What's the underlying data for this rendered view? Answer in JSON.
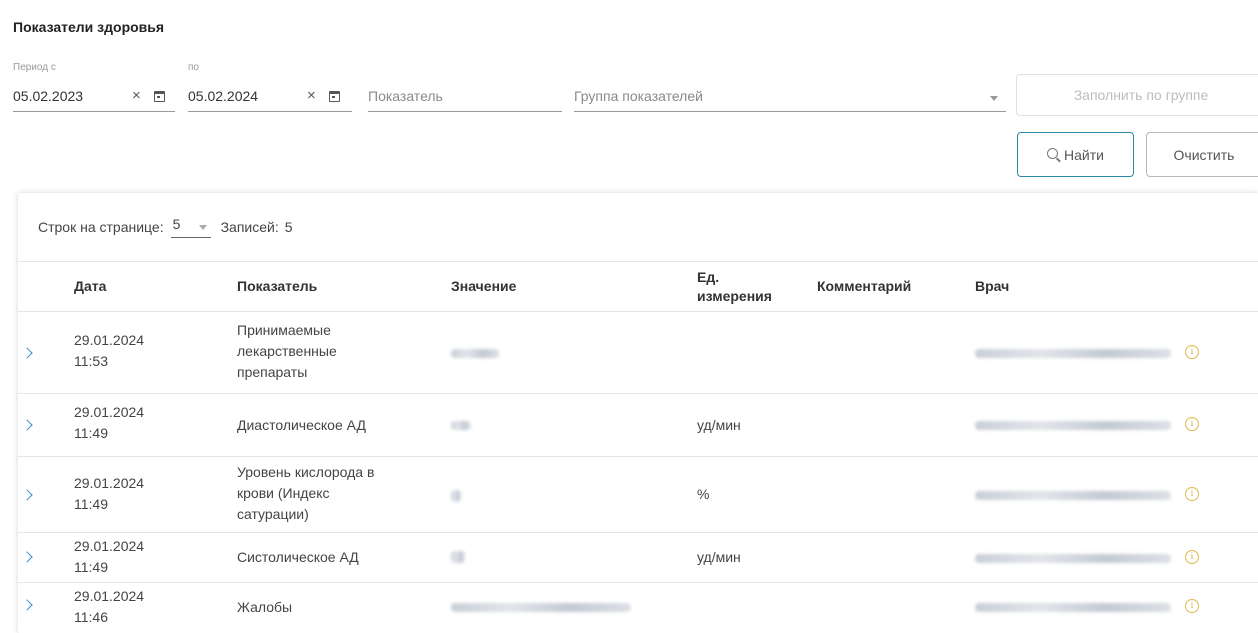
{
  "page": {
    "title": "Показатели здоровья"
  },
  "filters": {
    "period_from_label": "Период с",
    "period_from_value": "05.02.2023",
    "period_to_label": "по",
    "period_to_value": "05.02.2024",
    "clear_glyph": "×",
    "indicator_placeholder": "Показатель",
    "group_placeholder": "Группа показателей",
    "fill_by_group_label": "Заполнить по группе",
    "find_label": "Найти",
    "clear_label": "Очистить"
  },
  "table": {
    "rows_per_page_label": "Строк на странице:",
    "rows_per_page_value": "5",
    "records_label": "Записей:",
    "records_count": "5",
    "columns": {
      "date": "Дата",
      "indicator": "Показатель",
      "value": "Значение",
      "unit": "Ед. измерения",
      "comment": "Комментарий",
      "doctor": "Врач"
    },
    "rows": [
      {
        "date": "29.01.2024",
        "time": "11:53",
        "indicator": "Принимаемые лекарственные препараты",
        "unit": "",
        "comment": ""
      },
      {
        "date": "29.01.2024",
        "time": "11:49",
        "indicator": "Диастолическое АД",
        "unit": "уд/мин",
        "comment": ""
      },
      {
        "date": "29.01.2024",
        "time": "11:49",
        "indicator": "Уровень кислорода в крови (Индекс сатурации)",
        "unit": "%",
        "comment": ""
      },
      {
        "date": "29.01.2024",
        "time": "11:49",
        "indicator": "Систолическое АД",
        "unit": "уд/мин",
        "comment": ""
      },
      {
        "date": "29.01.2024",
        "time": "11:46",
        "indicator": "Жалобы",
        "unit": "",
        "comment": ""
      }
    ]
  },
  "icons": {
    "expand": "chevron-right-icon",
    "info": "info-icon",
    "calendar": "calendar-icon",
    "clear": "close-icon",
    "search": "search-icon"
  },
  "colors": {
    "accent": "#2a8aa6",
    "chevron": "#3b8ec9",
    "info": "#e0b84c"
  }
}
